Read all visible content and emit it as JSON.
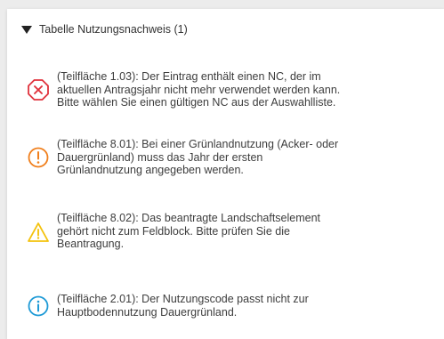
{
  "section": {
    "title": "Tabelle Nutzungsnachweis (1)"
  },
  "colors": {
    "error": "#e0323c",
    "warning_orange": "#f07f1c",
    "warning_yellow": "#f4c20d",
    "info": "#1e9ad6"
  },
  "messages": [
    {
      "severity": "error",
      "icon": "error-x-octagon-icon",
      "text": "(Teilfläche 1.03): Der Eintrag enthält einen NC, der im\naktuellen Antragsjahr nicht mehr verwendet werden kann.\nBitte wählen Sie einen gültigen NC aus der Auswahlliste."
    },
    {
      "severity": "warning",
      "icon": "exclamation-circle-icon",
      "text": "(Teilfläche 8.01): Bei einer Grünlandnutzung (Acker- oder\nDauergrünland) muss das Jahr der ersten\nGrünlandnutzung angegeben werden."
    },
    {
      "severity": "caution",
      "icon": "warning-triangle-icon",
      "text": "(Teilfläche 8.02): Das beantragte Landschaftselement\ngehört nicht zum Feldblock. Bitte prüfen Sie die\nBeantragung."
    },
    {
      "severity": "info",
      "icon": "info-circle-icon",
      "text": "(Teilfläche 2.01): Der Nutzungscode passt nicht zur\nHauptbodennutzung Dauergrünland."
    }
  ]
}
